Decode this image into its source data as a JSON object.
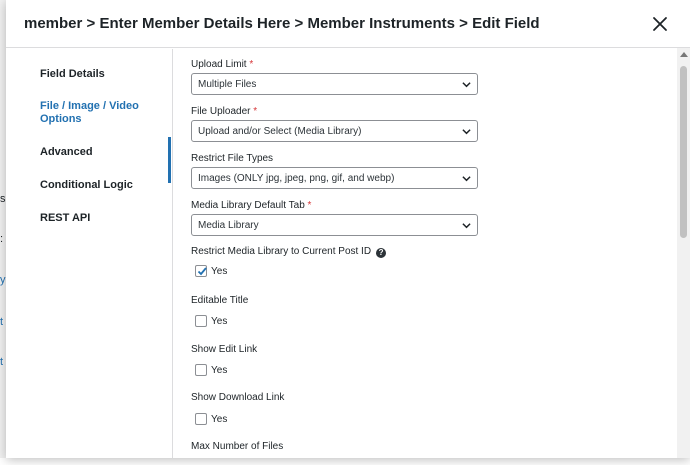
{
  "breadcrumb": "member > Enter Member Details Here > Member Instruments > Edit Field",
  "sidebar": {
    "items": [
      {
        "label": "Field Details"
      },
      {
        "label": "File / Image / Video"
      },
      {
        "label": "Options"
      },
      {
        "label": "Advanced"
      },
      {
        "label": "Conditional Logic"
      },
      {
        "label": "REST API"
      }
    ]
  },
  "fields": {
    "upload_limit": {
      "label": "Upload Limit",
      "required": "*",
      "value": "Multiple Files"
    },
    "file_uploader": {
      "label": "File Uploader",
      "required": "*",
      "value": "Upload and/or Select (Media Library)"
    },
    "restrict_types": {
      "label": "Restrict File Types",
      "value": "Images (ONLY jpg, jpeg, png, gif, and webp)"
    },
    "media_tab": {
      "label": "Media Library Default Tab",
      "required": "*",
      "value": "Media Library"
    },
    "restrict_media": {
      "label": "Restrict Media Library to Current Post ID",
      "help": "?",
      "option": "Yes",
      "checked": true
    },
    "editable_title": {
      "label": "Editable Title",
      "option": "Yes",
      "checked": false
    },
    "show_edit_link": {
      "label": "Show Edit Link",
      "option": "Yes",
      "checked": false
    },
    "show_download_link": {
      "label": "Show Download Link",
      "option": "Yes",
      "checked": false
    },
    "max_files": {
      "label": "Max Number of Files"
    }
  },
  "colors": {
    "accent": "#2271b1",
    "required": "#d63638",
    "border": "#8c8f94"
  },
  "icons": {
    "close": "close-icon",
    "dropdown": "chevron-down-icon",
    "check": "checkmark-icon",
    "help": "help-icon"
  }
}
